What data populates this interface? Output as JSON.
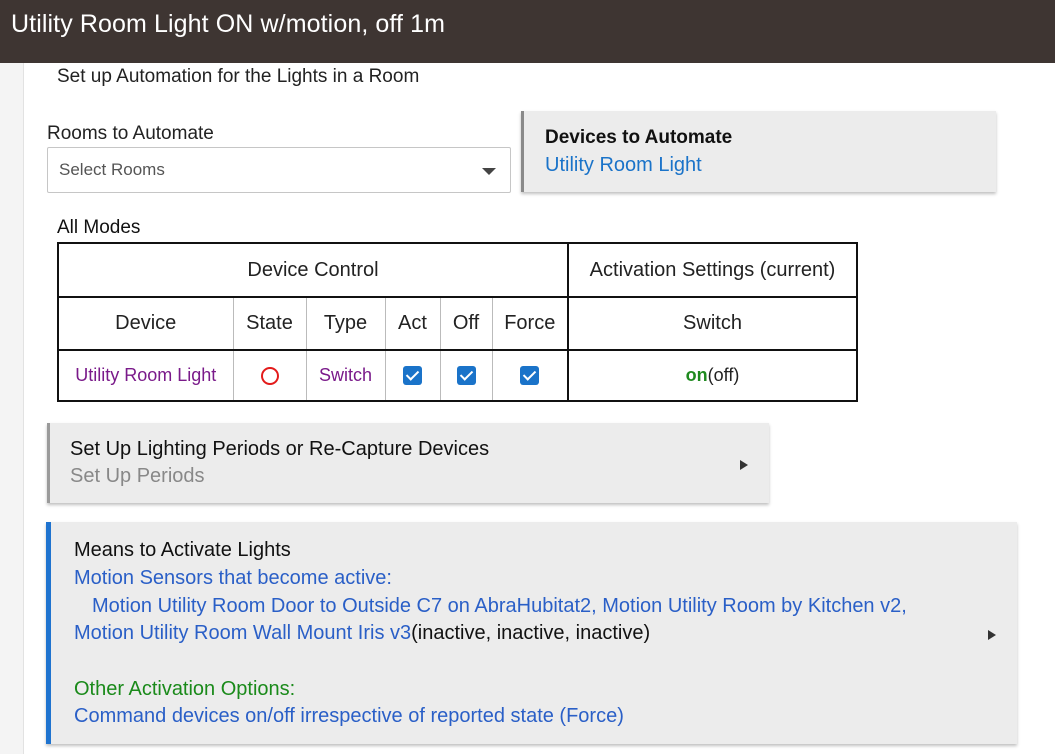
{
  "window": {
    "title": "Utility Room Light ON w/motion, off 1m"
  },
  "page": {
    "subtitle": "Set up Automation for the Lights in a Room"
  },
  "rooms": {
    "label": "Rooms to Automate",
    "placeholder": "Select Rooms"
  },
  "devices": {
    "heading": "Devices to Automate",
    "value": "Utility Room Light"
  },
  "modes": {
    "label": "All Modes"
  },
  "table": {
    "group_device_control": "Device Control",
    "group_activation": "Activation Settings (current)",
    "headers": {
      "device": "Device",
      "state": "State",
      "type": "Type",
      "act": "Act",
      "off": "Off",
      "force": "Force",
      "switch": "Switch"
    },
    "rows": [
      {
        "device": "Utility Room Light",
        "type": "Switch",
        "switch_on": "on",
        "switch_current": "(off)"
      }
    ]
  },
  "periods": {
    "title": "Set Up Lighting Periods or Re-Capture Devices",
    "subtitle": "Set Up Periods"
  },
  "means": {
    "title": "Means to Activate Lights",
    "motion_label": "Motion Sensors that become active:",
    "motion_sensors_line1": "Motion Utility Room Door to Outside C7 on AbraHubitat2, Motion Utility Room by Kitchen v2,",
    "motion_sensors_line2": "Motion Utility Room Wall Mount Iris v3",
    "motion_states": "(inactive, inactive, inactive)",
    "other_label": "Other Activation Options:",
    "other_value": "Command devices on/off irrespective of reported state (Force)"
  },
  "colors": {
    "titlebar": "#3e3532",
    "link_blue": "#1a73c9",
    "device_purple": "#7a1a8a",
    "on_green": "#1f8a1f",
    "state_red": "#e31b1b",
    "means_accent": "#1f73cf"
  },
  "icons": {
    "state": "off-state-ring-icon",
    "checkbox": "checkbox-checked-icon",
    "dropdown": "chevron-down-icon",
    "expand": "expand-right-triangle-icon"
  }
}
